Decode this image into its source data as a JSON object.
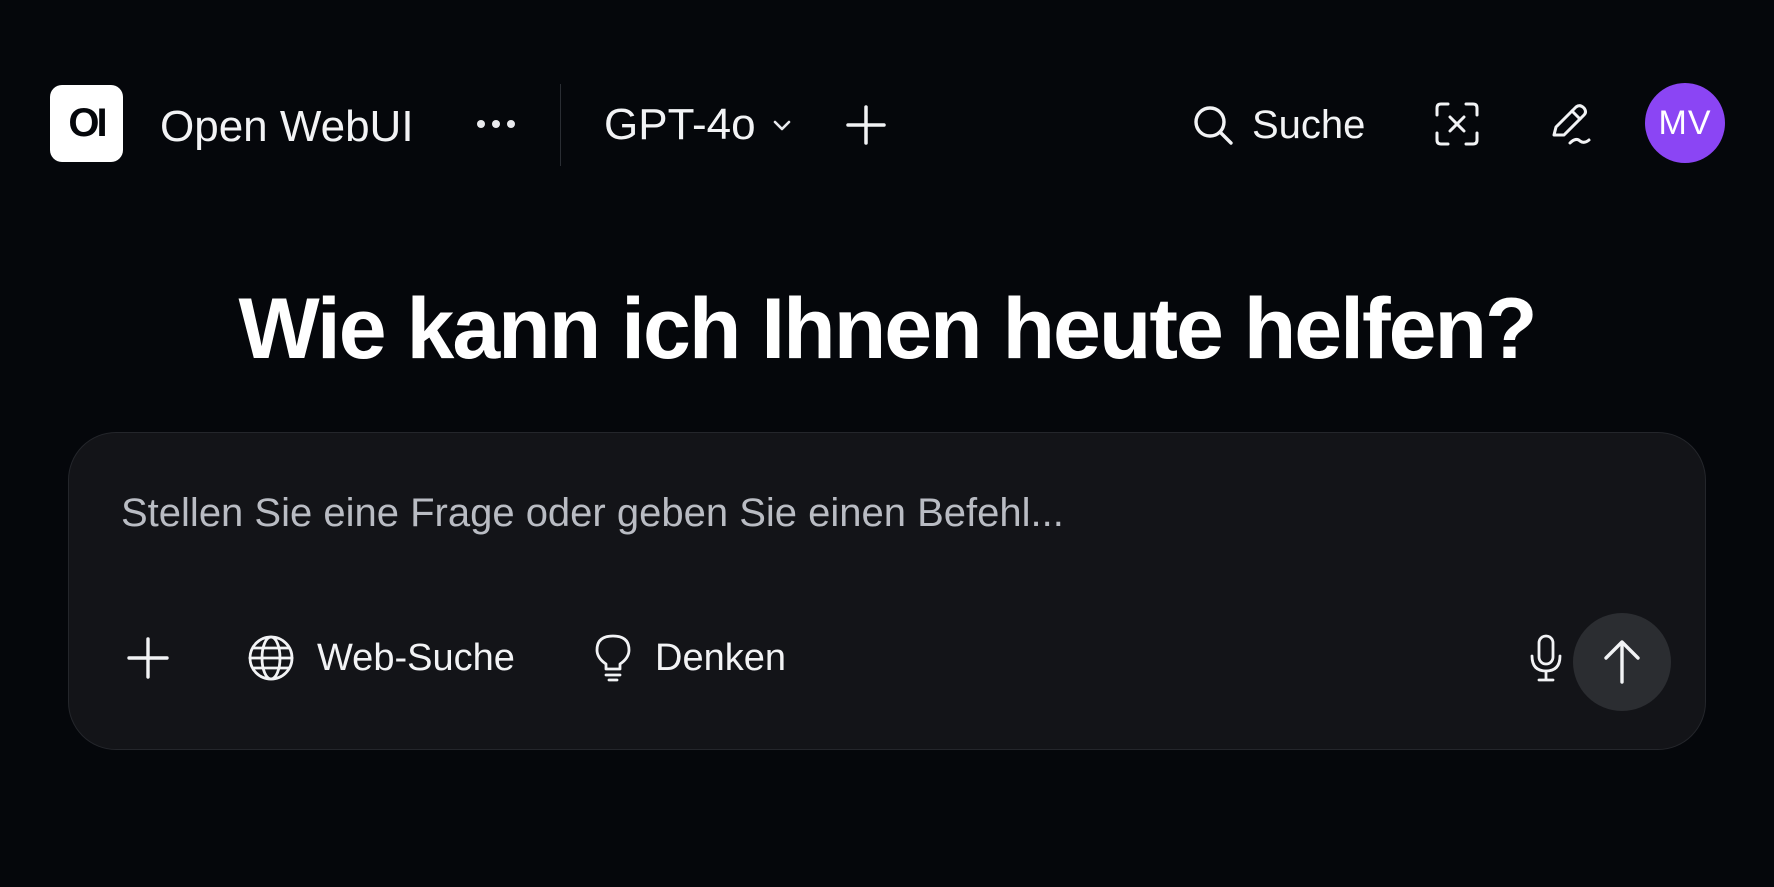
{
  "header": {
    "logo_text": "OI",
    "app_title": "Open WebUI",
    "more_icon": "more-horizontal-icon",
    "model": {
      "label": "GPT-4o",
      "icon": "chevron-down-icon"
    },
    "new_chat_icon": "plus-icon",
    "search": {
      "label": "Suche",
      "icon": "search-icon"
    },
    "temporary_chat_icon": "temporary-chat-icon",
    "edit_icon": "pencil-icon",
    "avatar": {
      "initials": "MV",
      "color": "#8b45f4"
    }
  },
  "main": {
    "greeting": "Wie kann ich Ihnen heute helfen?"
  },
  "composer": {
    "placeholder": "Stellen Sie eine Frage oder geben Sie einen Befehl...",
    "value": "",
    "attach_icon": "plus-icon",
    "web_search": {
      "label": "Web-Suche",
      "icon": "globe-icon"
    },
    "think": {
      "label": "Denken",
      "icon": "lightbulb-icon"
    },
    "mic_icon": "microphone-icon",
    "send_icon": "arrow-up-icon"
  },
  "colors": {
    "background": "#05070b",
    "composer_bg": "#131418",
    "send_button_bg": "#2b2d31",
    "accent_avatar": "#8b45f4",
    "text_primary": "#ffffff"
  }
}
